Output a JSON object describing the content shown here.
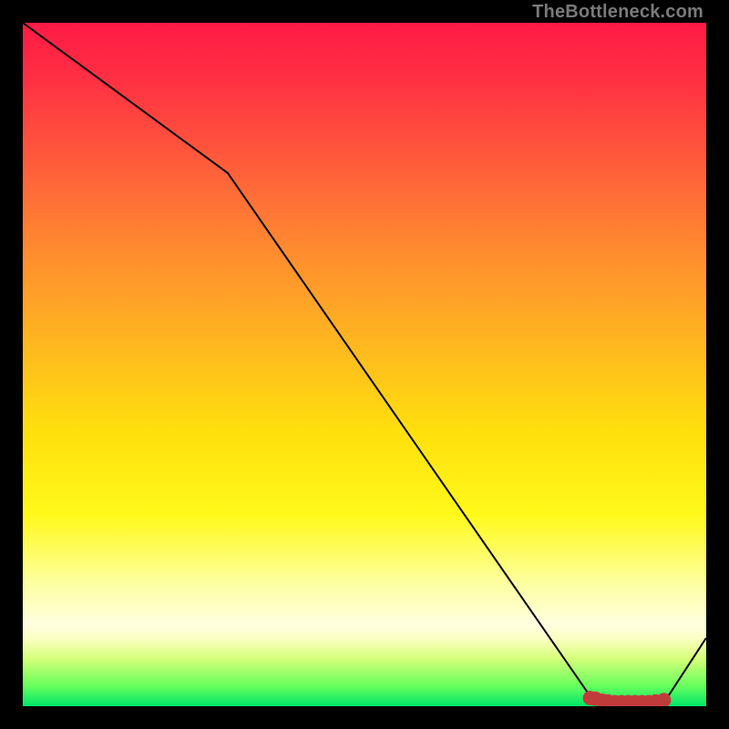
{
  "watermark": "TheBottleneck.com",
  "chart_data": {
    "type": "line",
    "title": "",
    "xlabel": "",
    "ylabel": "",
    "xlim": [
      0,
      100
    ],
    "ylim": [
      0,
      100
    ],
    "grid": false,
    "line": {
      "name": "bottleneck-curve",
      "x": [
        0,
        30,
        83,
        86,
        88,
        90,
        92,
        94,
        100
      ],
      "y": [
        100,
        78,
        1.5,
        0.5,
        0.5,
        0.5,
        0.5,
        0.8,
        10
      ]
    },
    "markers": {
      "name": "optimal-range-points",
      "x": [
        83.0,
        83.8,
        84.8,
        85.6,
        86.6,
        87.6,
        88.6,
        89.6,
        90.6,
        91.6,
        92.6,
        93.8
      ],
      "y": [
        1.2,
        1.1,
        0.8,
        0.7,
        0.6,
        0.6,
        0.6,
        0.6,
        0.6,
        0.6,
        0.7,
        0.9
      ]
    }
  }
}
